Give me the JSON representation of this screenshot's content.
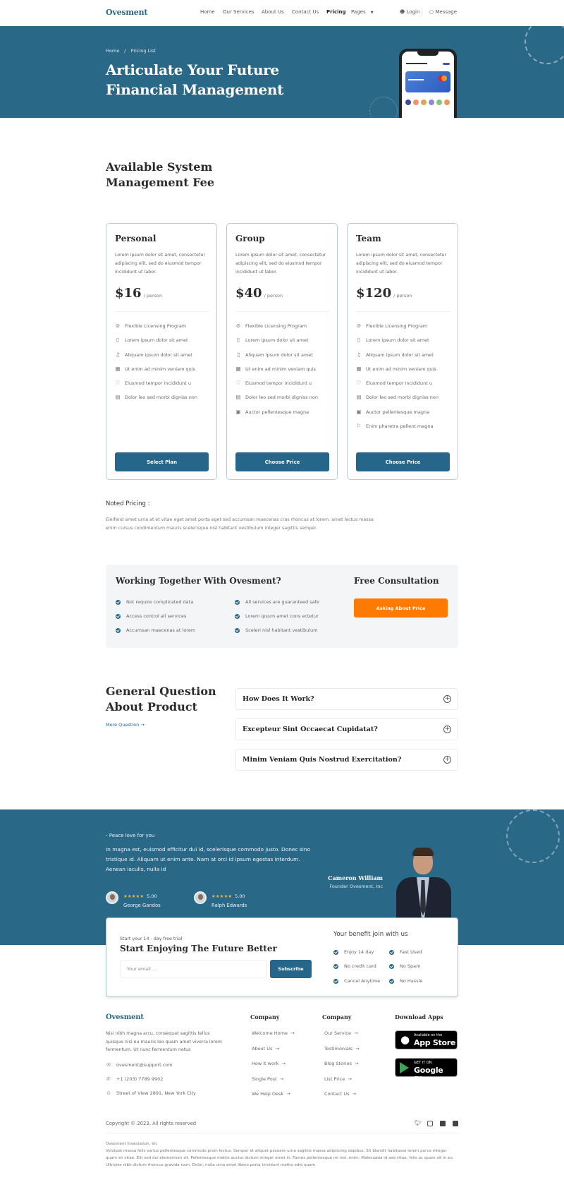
{
  "header": {
    "logo": "Ovesment",
    "nav": [
      "Home",
      "Our Services",
      "About Us",
      "Contact Us",
      "Pricing",
      "Pages"
    ],
    "active_nav": "Pricing",
    "login": "Login",
    "message": "Message"
  },
  "hero": {
    "breadcrumb": [
      "Home",
      "Pricing List"
    ],
    "title_line1": "Articulate Your Future",
    "title_line2": "Financial Management"
  },
  "pricing": {
    "title_line1": "Available System",
    "title_line2": "Management Fee",
    "plans": [
      {
        "name": "Personal",
        "description": "Lorem ipsum dolor sit amet, consectetur adipiscing elit, sed do eiusmod tempor incididunt ut labor.",
        "price": "$16",
        "unit": "/ person",
        "features": [
          {
            "icon": "compass-icon",
            "text": "Flexible Licensing Program"
          },
          {
            "icon": "clipboard-icon",
            "text": "Lorem ipsum dolor sit amet"
          },
          {
            "icon": "bell-icon",
            "text": "Aliquam ipsum dolor sit amet"
          },
          {
            "icon": "building-icon",
            "text": "Ut enim ad minim veniam quis"
          },
          {
            "icon": "heart-icon",
            "text": "Eiusmod tempor incididunt u"
          },
          {
            "icon": "keyboard-icon",
            "text": "Dolor leo sed morbi digniss non"
          }
        ],
        "button": "Select Plan"
      },
      {
        "name": "Group",
        "description": "Lorem ipsum dolor sit amet, consectetur adipiscing elit, sed do eiusmod tempor incididunt ut labor.",
        "price": "$40",
        "unit": "/ person",
        "features": [
          {
            "icon": "compass-icon",
            "text": "Flexible Licensing Program"
          },
          {
            "icon": "clipboard-icon",
            "text": "Lorem ipsum dolor sit amet"
          },
          {
            "icon": "bell-icon",
            "text": "Aliquam ipsum dolor sit amet"
          },
          {
            "icon": "building-icon",
            "text": "Ut enim ad minim veniam quis"
          },
          {
            "icon": "heart-icon",
            "text": "Eiusmod tempor incididunt u"
          },
          {
            "icon": "keyboard-icon",
            "text": "Dolor leo sed morbi digniss non"
          },
          {
            "icon": "save-icon",
            "text": "Auctor pellentesque magna"
          }
        ],
        "button": "Choose Price"
      },
      {
        "name": "Team",
        "description": "Lorem ipsum dolor sit amet, consectetur adipiscing elit, sed do eiusmod tempor incididunt ut labor.",
        "price": "$120",
        "unit": "/ person",
        "features": [
          {
            "icon": "compass-icon",
            "text": "Flexible Licensing Program"
          },
          {
            "icon": "clipboard-icon",
            "text": "Lorem ipsum dolor sit amet"
          },
          {
            "icon": "bell-icon",
            "text": "Aliquam ipsum dolor sit amet"
          },
          {
            "icon": "building-icon",
            "text": "Ut enim ad minim veniam quis"
          },
          {
            "icon": "heart-icon",
            "text": "Eiusmod tempor incididunt u"
          },
          {
            "icon": "keyboard-icon",
            "text": "Dolor leo sed morbi digniss non"
          },
          {
            "icon": "save-icon",
            "text": "Auctor pellentesque magna"
          },
          {
            "icon": "flag-icon",
            "text": "Enim pharetra pellent magna"
          }
        ],
        "button": "Choose Price"
      }
    ],
    "noted_title": "Noted Pricing :",
    "noted_text": "Eleifend amet urna at et vitae eget amet porta eget sed accumsan maecenas cras rhoncus at lorem. amet lectus massa enim cursus condimentum mauris scelerisque nisl habitant vestibulum integer sagittis semper."
  },
  "working": {
    "title": "Working Together With Ovesment?",
    "items": [
      "Not require complicated data",
      "Access control all services",
      "Accumsan maecenas at lorem",
      "All services are guaranteed safe",
      "Lorem ipsum amet cons ectetur",
      "Sceleri nisl habitant vestibulum"
    ],
    "consult_title": "Free Consultation",
    "consult_button": "Asking About Price"
  },
  "faq": {
    "title_line1": "General Question",
    "title_line2": "About Product",
    "more": "More Question",
    "questions": [
      "How Does It Work?",
      "Excepteur Sint Occaecat Cupidatat?",
      "Minim Veniam Quis Nostrud Exercitation?"
    ]
  },
  "testimonial": {
    "tagline": "- Peace love for you",
    "quote": "In magna est, euismod efficitur dui id, scelerisque commodo justo. Donec sino tristique id. Aliquam ut enim ante. Nam at orci id ipsum egestas interdum. Aenean iaculis, nulla id",
    "reviewers": [
      {
        "name": "George Gandos",
        "rating": "5.00",
        "stars": "★★★★★"
      },
      {
        "name": "Ralph Edwards",
        "rating": "5.00",
        "stars": "★★★★★"
      }
    ],
    "founder_name": "Cameron William",
    "founder_role": "Founder Ovesment, Inc"
  },
  "subscribe": {
    "small": "Start your 14 - day free trial",
    "title": "Start Enjoying The Future Better",
    "email_placeholder": "Your email ...",
    "button": "Subscribe",
    "benefits_title": "Your benefit join with us",
    "benefits": [
      "Enjoy 14 day",
      "No credit card",
      "Cancel Anytime",
      "Fast Used",
      "No Spam",
      "No Hassle"
    ]
  },
  "footer": {
    "logo": "Ovesment",
    "description": "Nisi nibh magna arcu, consequat sagittis tellus quisque nisi eu mauris leo quam amet viverra lorem fermentum. Ut nunc fermentum netus",
    "email": "ovesment@support.com",
    "phone": "+1 (203) 7789 9902",
    "address": "Street of View 2891, New York City",
    "col1_title": "Company",
    "col1_links": [
      "Welcome Home",
      "About Us",
      "How it work",
      "Single Post",
      "We Help Desk"
    ],
    "col2_title": "Company",
    "col2_links": [
      "Our Service",
      "Testimonials",
      "Blog Stories",
      "List Price",
      "Contact Us"
    ],
    "apps_title": "Download Apps",
    "appstore_small": "Available on the",
    "appstore_big": "App Store",
    "googleplay_small": "GET IT ON",
    "googleplay_big": "Google Play",
    "copyright": "Copyright © 2023. All rights reserved",
    "legal_company": "Ovesment Investation, Inc",
    "legal_text": "Volutpat massa felis varius pellentesque commodo proin lectus. Semper et aliquet posuere urna sagittis massa adipiscing dapibus. Sit blandit habitasse lorem purus integer quam sit vitae. Elit sed dui elementum sit. Pellentesque mattis auctor dictum integer amet in. Fames pellentesque mi nisl, enim. Malesuada id sed vitae, felis ac quam sit in eu. Ultricies nibh dictum rhoncus gravida nam. Dolor, nulla urna amet libero porta tincidunt mattis odio quam"
  },
  "colors": {
    "primary": "#2a6888",
    "accent": "#ff7a00"
  }
}
